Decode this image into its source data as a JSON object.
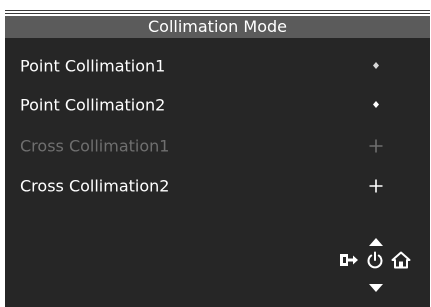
{
  "osd": {
    "title": "Collimation Mode",
    "items": [
      {
        "label": "Point Collimation1",
        "marker_icon": "point-diamond",
        "enabled": true
      },
      {
        "label": "Point Collimation2",
        "marker_icon": "point-diamond",
        "enabled": true
      },
      {
        "label": "Cross Collimation1",
        "marker_icon": "cross-plus",
        "enabled": false
      },
      {
        "label": "Cross Collimation2",
        "marker_icon": "cross-plus",
        "enabled": true
      }
    ],
    "controls": {
      "icons": [
        "up-arrow",
        "exit",
        "power",
        "home",
        "down-arrow"
      ]
    },
    "colors": {
      "background": "#262626",
      "title_bar": "#5b5b5b",
      "text": "#ffffff",
      "disabled_text": "#6f6f6f"
    }
  }
}
